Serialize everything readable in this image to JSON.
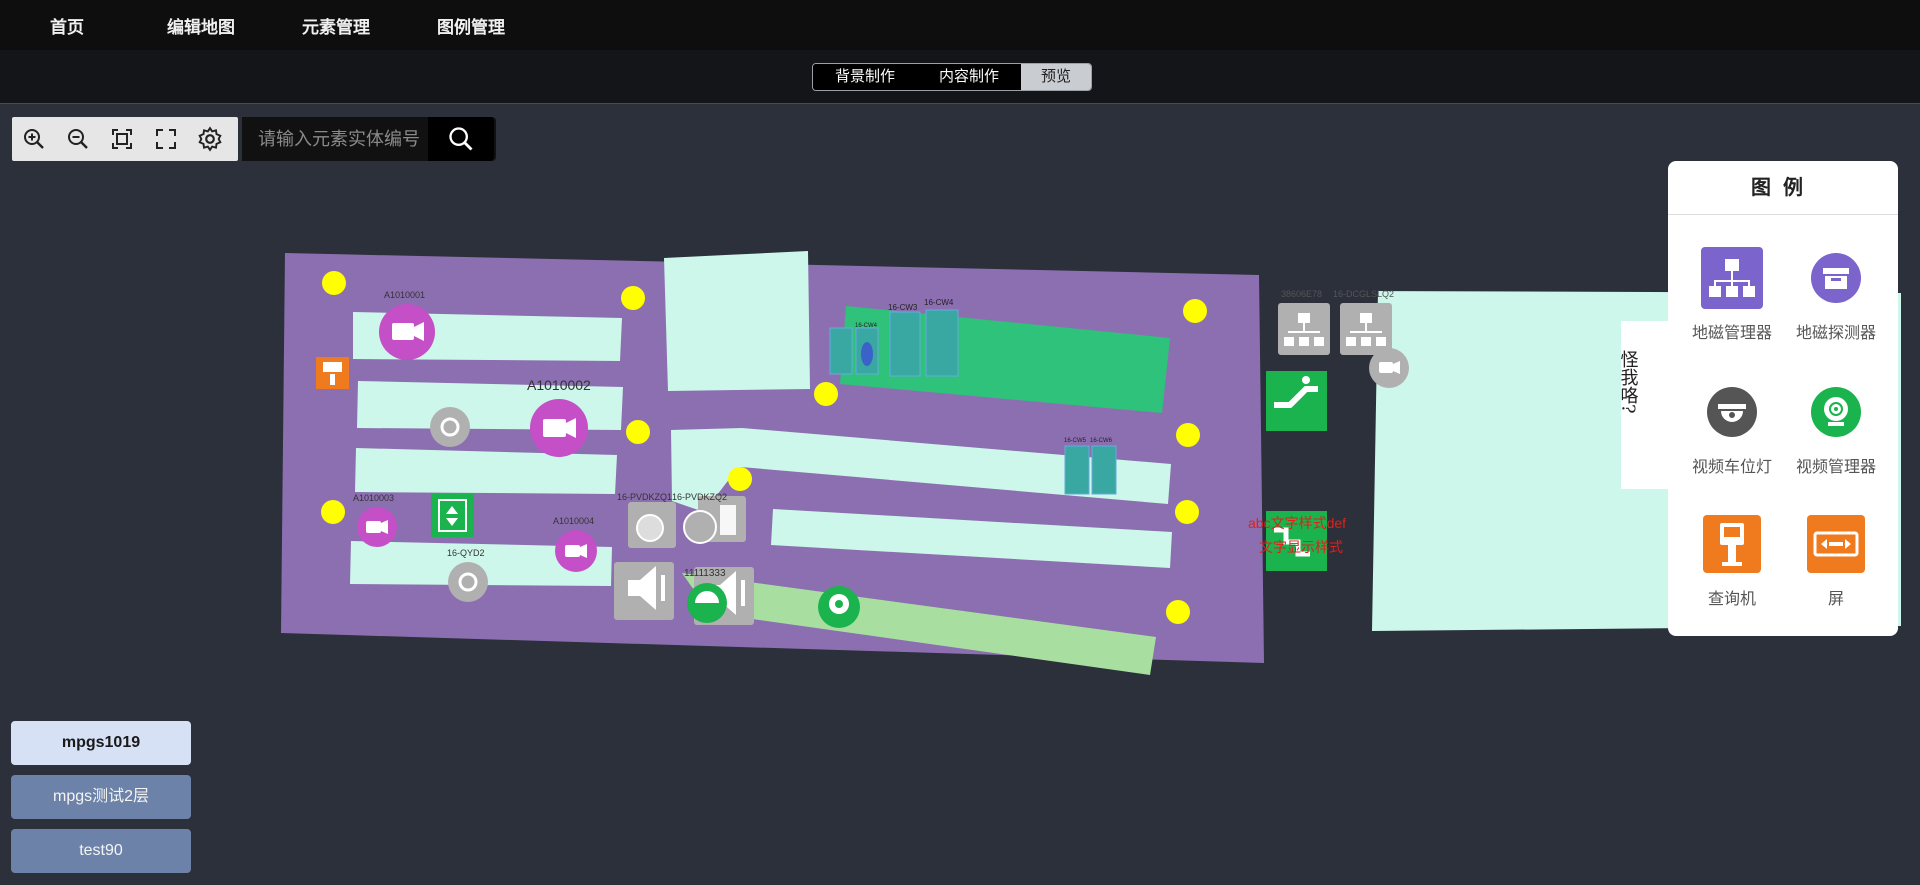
{
  "nav": {
    "items": [
      {
        "label": "首页"
      },
      {
        "label": "编辑地图"
      },
      {
        "label": "元素管理"
      },
      {
        "label": "图例管理"
      }
    ]
  },
  "mode_tabs": {
    "background": "背景制作",
    "content": "内容制作",
    "preview": "预览",
    "active": "预览"
  },
  "toolbar": {
    "icons": [
      "zoom-in-icon",
      "zoom-out-icon",
      "fit-view-icon",
      "fullscreen-icon",
      "settings-icon"
    ]
  },
  "search": {
    "placeholder": "请输入元素实体编号",
    "value": ""
  },
  "map": {
    "labels": {
      "cam1": "A1010001",
      "cam2": "A1010002",
      "cam3": "A1010003",
      "cam4": "A1010004",
      "qyd2": "16-QYD2",
      "pvdk1": "16-PVDKZQ1",
      "pvdk2": "16-PVDKZQ2",
      "num1111": "11111333",
      "cw4": "16-CW4",
      "cw3": "16-CW3",
      "cw_small": "16-CW4",
      "cw5": "16-CW5",
      "cw6": "16-CW6",
      "n3860": "38606E78",
      "dcgl": "16-DCGLSLQ2",
      "red_text_1": "abc文字样式def",
      "red_text_2": "文字显示样式",
      "handwriting": "怪我咯?"
    },
    "colors": {
      "floor": "#8c6fb0",
      "room": "#cdf7ea",
      "green_zone": "#2fc27a",
      "light_green": "#a8dfa0",
      "yellow_marker": "#ffff00",
      "camera_magenta": "#c44fc7",
      "device_grey": "#b0b0b0",
      "device_green": "#1ab34d",
      "kiosk_orange": "#f07a1e"
    }
  },
  "legend": {
    "title": "图例",
    "items": [
      {
        "label": "地磁管理器",
        "icon": "network-manager-icon",
        "color": "#7b64cc"
      },
      {
        "label": "地磁探测器",
        "icon": "detector-icon",
        "color": "#7b64cc"
      },
      {
        "label": "视频车位灯",
        "icon": "dome-light-icon",
        "color": "#555555"
      },
      {
        "label": "视频管理器",
        "icon": "webcam-icon",
        "color": "#1ab34d"
      },
      {
        "label": "查询机",
        "icon": "kiosk-icon",
        "color": "#f07a1e"
      },
      {
        "label": "屏",
        "icon": "screen-icon",
        "color": "#f07a1e"
      }
    ]
  },
  "floors": {
    "items": [
      {
        "label": "mpgs1019",
        "selected": true
      },
      {
        "label": "mpgs测试2层",
        "selected": false
      },
      {
        "label": "test90",
        "selected": false
      }
    ]
  }
}
